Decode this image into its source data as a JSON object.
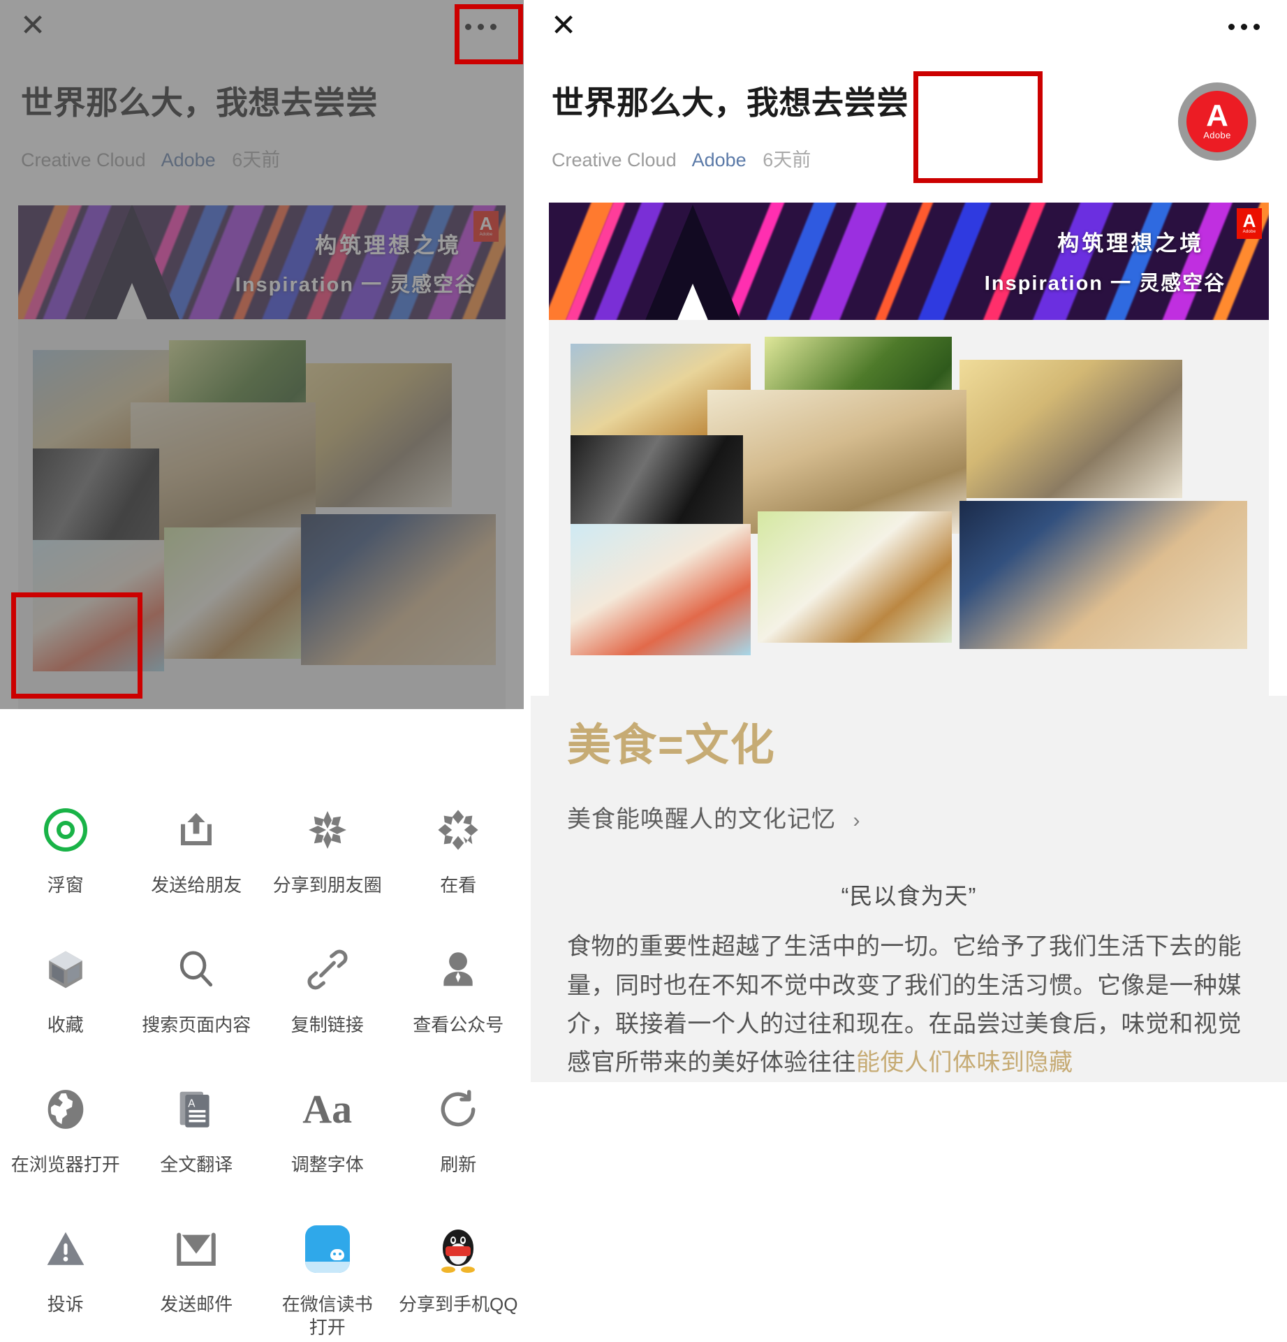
{
  "nav": {
    "close_icon": "close-icon",
    "more_icon": "more-options-icon"
  },
  "article": {
    "title": "世界那么大，我想去尝尝",
    "account": "Creative Cloud",
    "author": "Adobe",
    "time": "6天前",
    "banner": {
      "line1": "构筑理想之境",
      "line2": "Inspiration 一 灵感空谷",
      "logo_glyph": "A",
      "logo_word": "Adobe"
    },
    "gold_heading": "美食=文化",
    "sub_line": "美食能唤醒人的文化记忆",
    "sub_chevron": "›",
    "quote": "“民以食为天”",
    "paragraph_plain": "食物的重要性超越了生活中的一切。它给予了我们生活下去的能量，同时也在不知不觉中改变了我们的生活习惯。它像是一种媒介，联接着一个人的过往和现在。在品尝过美食后，味觉和视觉感官所带来的美好体验往往",
    "paragraph_highlight": "能使人们体味到隐藏"
  },
  "avatar": {
    "glyph": "A",
    "word": "Adobe",
    "name": "adobe-avatar"
  },
  "share_sheet": {
    "items": [
      {
        "label": "浮窗",
        "icon": "float-window-icon"
      },
      {
        "label": "发送给朋友",
        "icon": "send-to-friend-icon"
      },
      {
        "label": "分享到朋友圈",
        "icon": "moments-icon"
      },
      {
        "label": "在看",
        "icon": "wow-icon"
      },
      {
        "label": "收藏",
        "icon": "favorite-box-icon"
      },
      {
        "label": "搜索页面内容",
        "icon": "search-icon"
      },
      {
        "label": "复制链接",
        "icon": "link-icon"
      },
      {
        "label": "查看公众号",
        "icon": "person-icon"
      },
      {
        "label": "在浏览器打开",
        "icon": "globe-icon"
      },
      {
        "label": "全文翻译",
        "icon": "translate-icon"
      },
      {
        "label": "调整字体",
        "icon": "font-size-icon"
      },
      {
        "label": "刷新",
        "icon": "refresh-icon"
      },
      {
        "label": "投诉",
        "icon": "warning-icon"
      },
      {
        "label": "发送邮件",
        "icon": "mail-icon"
      },
      {
        "label": "在微信读书\n打开",
        "icon": "wechat-read-icon"
      },
      {
        "label": "分享到手机QQ",
        "icon": "qq-icon"
      }
    ]
  },
  "colors": {
    "accent_green": "#19b347",
    "adobe_red": "#ec1c24",
    "annotation_red": "#cc0000",
    "gold": "#c6ab74",
    "dim_overlay": "#5f5f5f"
  }
}
